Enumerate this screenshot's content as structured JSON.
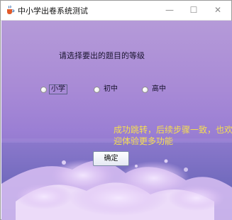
{
  "window": {
    "title": "中小学出卷系统测试",
    "minimize_glyph": "—",
    "maximize_glyph": "☐",
    "close_glyph": "✕",
    "icon": "java-coffee-icon"
  },
  "form": {
    "prompt": "请选择要出的题目的等级",
    "options": [
      {
        "label": "小学",
        "selected": false
      },
      {
        "label": "初中",
        "selected": false
      },
      {
        "label": "高中",
        "selected": false
      }
    ],
    "message_line1": "成功跳转，后续步骤一致，也欢",
    "message_line2": "迎体验更多功能",
    "confirm_label": "确定"
  },
  "colors": {
    "message": "#f6de4f",
    "background_top": "#b59ad8",
    "background_bottom": "#6a6cbb"
  }
}
